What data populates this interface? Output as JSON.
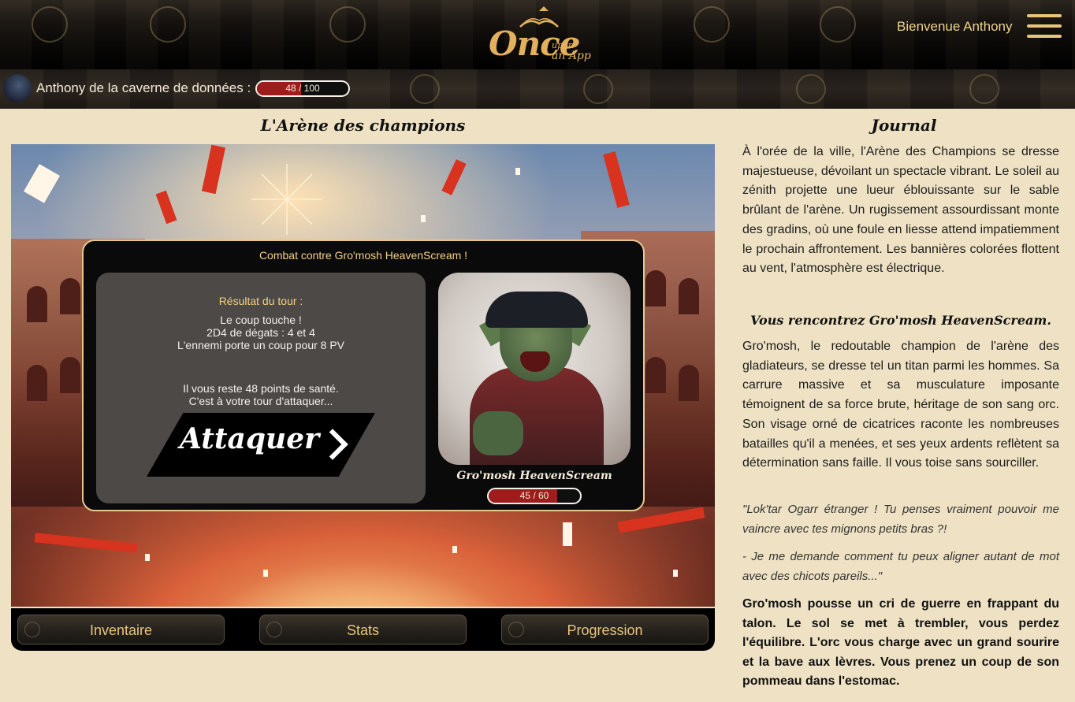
{
  "header": {
    "logo": {
      "word": "Once",
      "small_top": "upon",
      "small_bottom": "an App"
    },
    "welcome": "Bienvenue Anthony"
  },
  "player": {
    "name": "Anthony de la caverne de données :",
    "hp": {
      "current": 48,
      "max": 100,
      "label": "48 / 100"
    }
  },
  "arena": {
    "title": "L'Arène des champions",
    "combat": {
      "title": "Combat contre Gro'mosh HeavenScream !",
      "result_label": "Résultat du tour :",
      "result_lines": [
        "Le coup touche !",
        "2D4 de dégats : 4 et 4",
        "L'ennemi porte un coup pour 8 PV"
      ],
      "status_lines": [
        "Il vous reste 48 points de santé.",
        "C'est à votre tour d'attaquer..."
      ],
      "attack_label": "Attaquer",
      "enemy": {
        "name": "Gro'mosh HeavenScream",
        "hp": {
          "current": 45,
          "max": 60,
          "label": "45 / 60"
        }
      }
    }
  },
  "nav": {
    "inventory": "Inventaire",
    "stats": "Stats",
    "progression": "Progression"
  },
  "journal": {
    "title": "Journal",
    "intro": "À l'orée de la ville, l'Arène des Champions se dresse majestueuse, dévoilant un spectacle vibrant. Le soleil au zénith projette une lueur éblouissante sur le sable brûlant de l'arène. Un rugissement assourdissant monte des gradins, où une foule en liesse attend impatiemment le prochain affrontement. Les bannières colorées flottent au vent, l'atmosphère est électrique.",
    "subtitle": "Vous rencontrez Gro'mosh HeavenScream.",
    "description": "Gro'mosh, le redoutable champion de l'arène des gladiateurs, se dresse tel un titan parmi les hommes. Sa carrure massive et sa musculature imposante témoignent de sa force brute, héritage de son sang orc. Son visage orné de cicatrices raconte les nombreuses batailles qu'il a menées, et ses yeux ardents reflètent sa détermination sans faille. Il vous toise sans sourciller.",
    "quote1": "\"Lok'tar Ogarr étranger ! Tu penses vraiment pouvoir me vaincre avec tes mignons petits bras ?!",
    "quote2": "- Je me demande comment tu peux aligner autant de mot avec des chicots pareils...\"",
    "action": "Gro'mosh pousse un cri de guerre en frappant du talon. Le sol se met à trembler, vous perdez l'équilibre. L'orc vous charge avec un grand sourire et la bave aux lèvres. Vous prenez un coup de son pommeau dans l'estomac."
  }
}
